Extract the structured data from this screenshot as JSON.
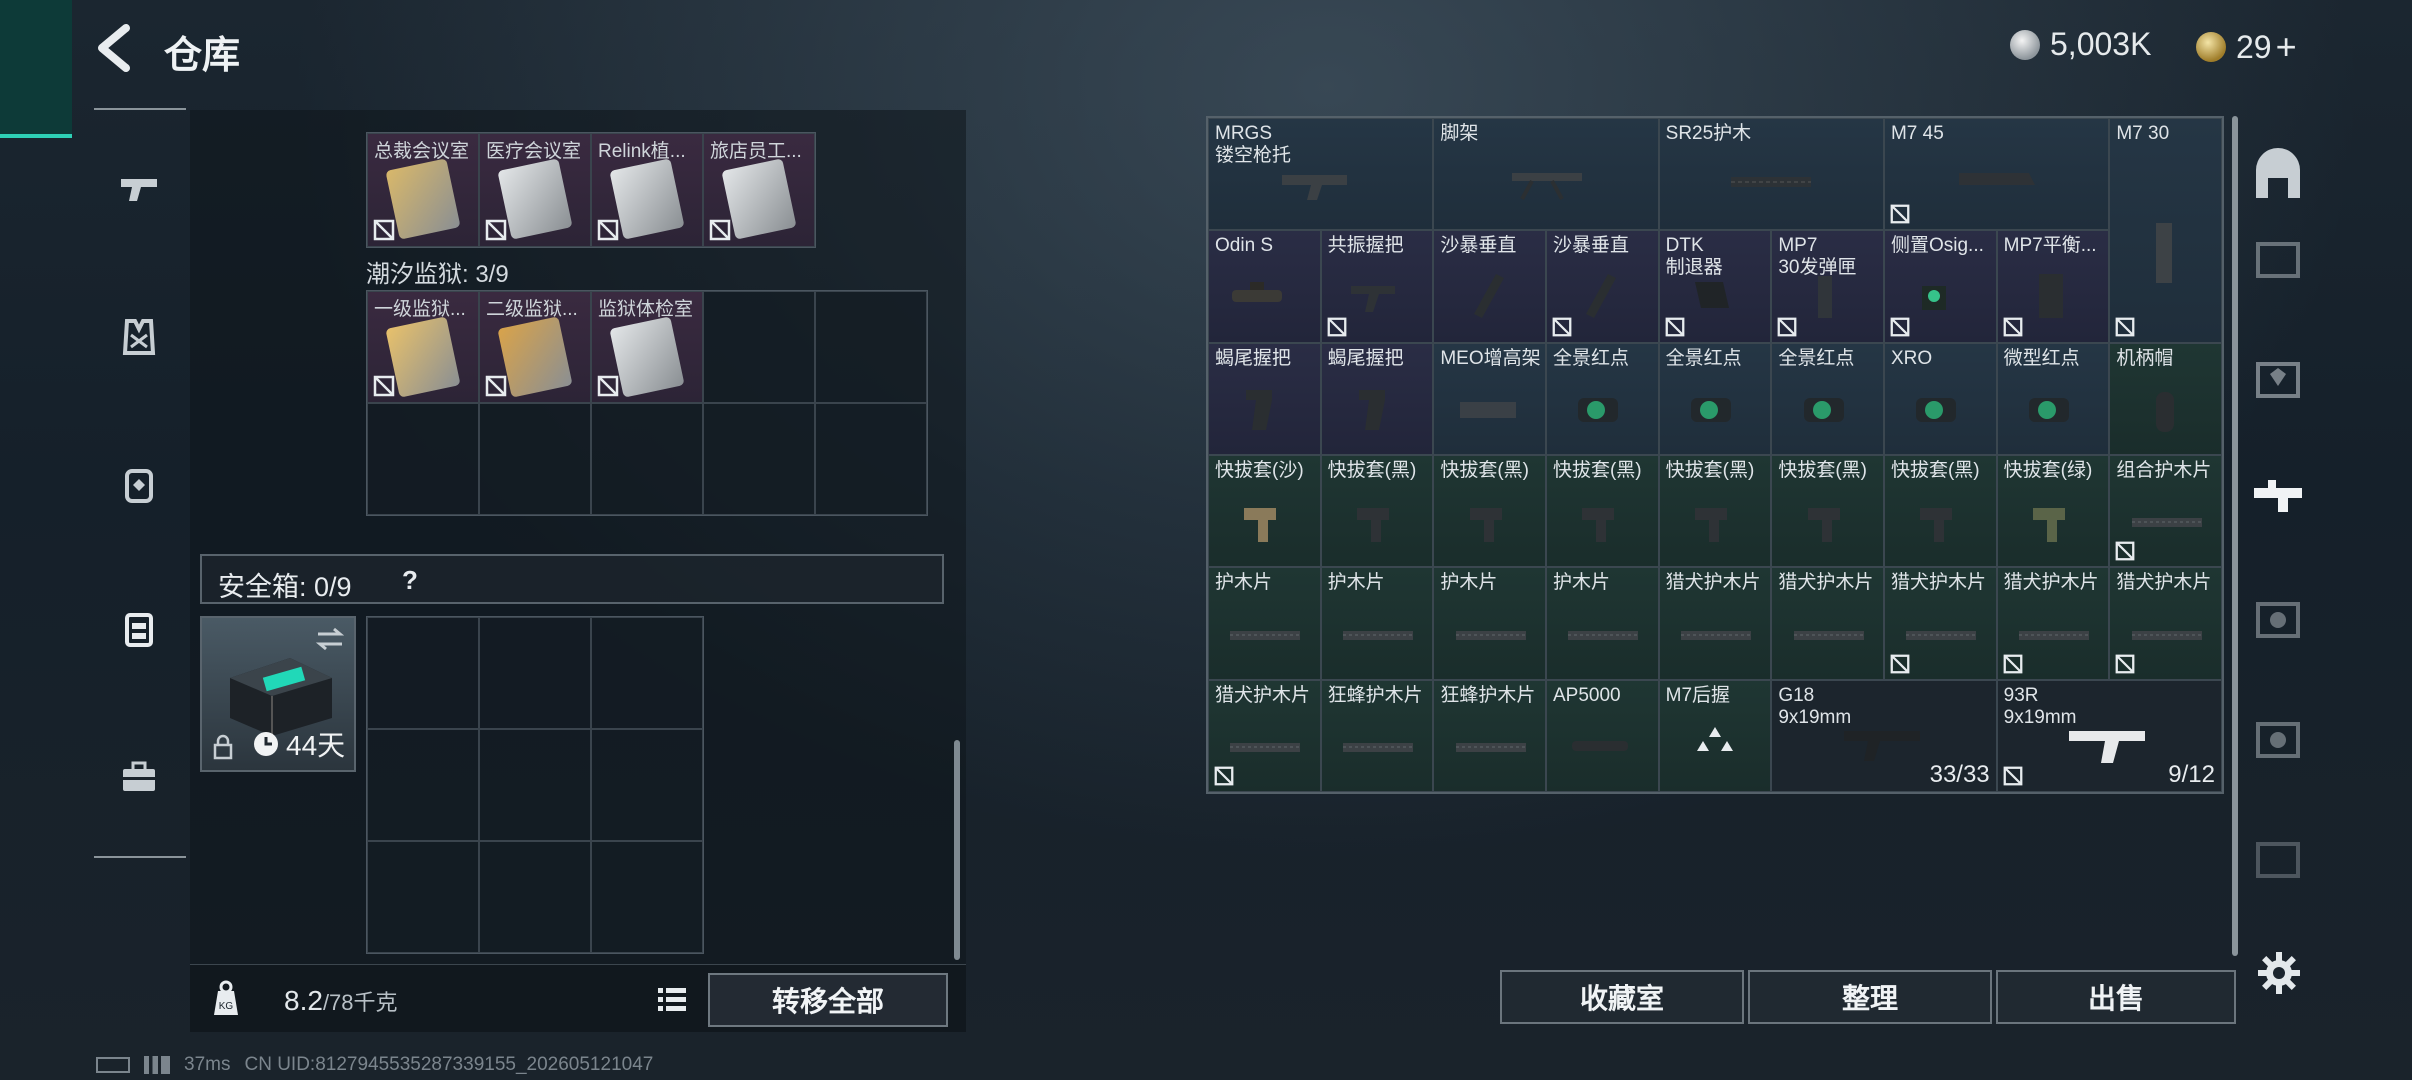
{
  "header": {
    "title": "仓库"
  },
  "currency": {
    "coins": "5,003K",
    "tokens": "29",
    "plus": "+"
  },
  "nav": [
    "weapons-tab",
    "armor-tab",
    "backpack-tab",
    "safe-case-tab",
    "toolbox-tab"
  ],
  "left": {
    "row1_cards": [
      {
        "label": "总裁会议室",
        "color": "#d9b86a"
      },
      {
        "label": "医疗会议室",
        "color": "#e3e6e8"
      },
      {
        "label": "Relink植...",
        "color": "#e3e6e8"
      },
      {
        "label": "旅店员工...",
        "color": "#e3e6e8"
      }
    ],
    "section2_title": "潮汐监狱: 3/9",
    "row2_cards": [
      {
        "label": "一级监狱...",
        "color": "#e8c16b"
      },
      {
        "label": "二级监狱...",
        "color": "#d9a34a"
      },
      {
        "label": "监狱体检室",
        "color": "#e3e6e8"
      }
    ],
    "safe_box": {
      "label": "安全箱: 0/9",
      "help": "?",
      "days": "44天"
    },
    "weight": {
      "value": "8.2",
      "max": "/78千克"
    },
    "transfer_all": "转移全部"
  },
  "right_grid": [
    {
      "label": "MRGS\n镂空枪托",
      "bg": "blue",
      "item": "stock"
    },
    {
      "label": "脚架",
      "bg": "blue",
      "item": "bipod"
    },
    {
      "label": "SR25护木",
      "bg": "blue",
      "item": "handguard"
    },
    {
      "label": "M7 45",
      "bg": "blue",
      "item": "mag-long",
      "nobid": true
    },
    {
      "label": "M7 30",
      "bg": "blue",
      "item": "mag-tall",
      "nobid": true
    },
    {
      "label": "Odin S",
      "bg": "purple",
      "item": "light"
    },
    {
      "label": "共振握把",
      "bg": "purple",
      "item": "grip",
      "nobid": true
    },
    {
      "label": "沙暴垂直",
      "bg": "purple",
      "item": "vgrip"
    },
    {
      "label": "沙暴垂直",
      "bg": "purple",
      "item": "vgrip",
      "nobid": true
    },
    {
      "label": "DTK\n制退器",
      "bg": "purple",
      "item": "muzzle",
      "nobid": true
    },
    {
      "label": "MP7\n30发弹匣",
      "bg": "purple",
      "item": "mag-small",
      "nobid": true
    },
    {
      "label": "侧置Osig...",
      "bg": "purple",
      "item": "sight-g",
      "nobid": true
    },
    {
      "label": "MP7平衡...",
      "bg": "purple",
      "item": "panel",
      "nobid": true
    },
    {
      "label": "蝎尾握把",
      "bg": "purple",
      "item": "pgrip"
    },
    {
      "label": "蝎尾握把",
      "bg": "purple",
      "item": "pgrip"
    },
    {
      "label": "MEO增高架",
      "bg": "blue",
      "item": "riser"
    },
    {
      "label": "全景红点",
      "bg": "blue",
      "item": "holo"
    },
    {
      "label": "全景红点",
      "bg": "blue",
      "item": "holo"
    },
    {
      "label": "全景红点",
      "bg": "blue",
      "item": "holo"
    },
    {
      "label": "XRO",
      "bg": "blue",
      "item": "holo"
    },
    {
      "label": "微型红点",
      "bg": "blue",
      "item": "holo"
    },
    {
      "label": "机柄帽",
      "bg": "green",
      "item": "cap"
    },
    {
      "label": "快拔套(沙)",
      "bg": "green",
      "item": "qd-sand"
    },
    {
      "label": "快拔套(黑)",
      "bg": "green",
      "item": "qd"
    },
    {
      "label": "快拔套(黑)",
      "bg": "green",
      "item": "qd"
    },
    {
      "label": "快拔套(黑)",
      "bg": "green",
      "item": "qd"
    },
    {
      "label": "快拔套(黑)",
      "bg": "green",
      "item": "qd"
    },
    {
      "label": "快拔套(黑)",
      "bg": "green",
      "item": "qd"
    },
    {
      "label": "快拔套(黑)",
      "bg": "green",
      "item": "qd"
    },
    {
      "label": "快拔套(绿)",
      "bg": "green",
      "item": "qd-green"
    },
    {
      "label": "组合护木片",
      "bg": "green",
      "item": "rail",
      "nobid": true
    },
    {
      "label": "护木片",
      "bg": "green",
      "item": "rail"
    },
    {
      "label": "护木片",
      "bg": "green",
      "item": "rail"
    },
    {
      "label": "护木片",
      "bg": "green",
      "item": "rail"
    },
    {
      "label": "护木片",
      "bg": "green",
      "item": "rail"
    },
    {
      "label": "猎犬护木片",
      "bg": "green",
      "item": "rail"
    },
    {
      "label": "猎犬护木片",
      "bg": "green",
      "item": "rail"
    },
    {
      "label": "猎犬护木片",
      "bg": "green",
      "item": "rail",
      "nobid": true
    },
    {
      "label": "猎犬护木片",
      "bg": "green",
      "item": "rail",
      "nobid": true
    },
    {
      "label": "猎犬护木片",
      "bg": "green",
      "item": "rail",
      "nobid": true
    },
    {
      "label": "猎犬护木片",
      "bg": "green",
      "item": "rail",
      "nobid": true
    },
    {
      "label": "狂蜂护木片",
      "bg": "green",
      "item": "rail"
    },
    {
      "label": "狂蜂护木片",
      "bg": "green",
      "item": "rail"
    },
    {
      "label": "AP5000",
      "bg": "green",
      "item": "scope"
    },
    {
      "label": "M7后握",
      "bg": "green",
      "item": "tri"
    },
    {
      "label": "G18\n9x19mm",
      "bg": "dark",
      "item": "pistol",
      "count": "33/33"
    },
    {
      "label": "93R\n9x19mm",
      "bg": "dark",
      "item": "pistol2",
      "count": "9/12",
      "nobid": true
    }
  ],
  "actions": {
    "collection": "收藏室",
    "sort": "整理",
    "sell": "出售"
  },
  "status": {
    "ping": "37ms",
    "uid": "CN UID:8127945535287339155_202605121047"
  }
}
